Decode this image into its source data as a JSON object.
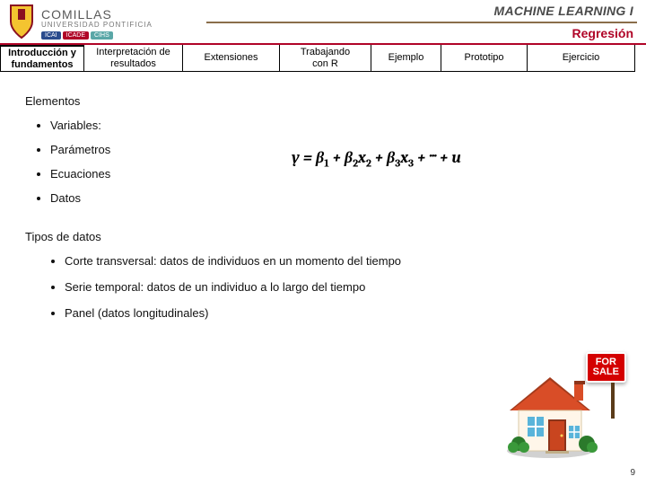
{
  "header": {
    "university": "COMILLAS",
    "subline": "UNIVERSIDAD PONTIFICIA",
    "chips": [
      "ICAI",
      "ICADE",
      "CIHS"
    ],
    "course": "MACHINE LEARNING I",
    "topic": "Regresión"
  },
  "tabs": [
    "Introducción y\nfundamentos",
    "Interpretación de\nresultados",
    "Extensiones",
    "Trabajando\ncon R",
    "Ejemplo",
    "Prototipo",
    "Ejercicio"
  ],
  "active_tab_index": 0,
  "section1_title": "Elementos",
  "section1_items": [
    "Variables:",
    "Parámetros",
    "Ecuaciones",
    "Datos"
  ],
  "section2_title": "Tipos de datos",
  "section2_items": [
    "Corte transversal: datos de individuos en un momento del tiempo",
    "Serie temporal: datos de un individuo a lo largo del tiempo",
    "Panel (datos longitudinales)"
  ],
  "equation_html": "y = β<span class=\"sub\">1</span> + β<span class=\"sub\">2</span>x<span class=\"sub\">2</span> + β<span class=\"sub\">3</span>x<span class=\"sub\">3</span> + ··· + u",
  "sign_text": "FOR\nSALE",
  "page_number": "9"
}
